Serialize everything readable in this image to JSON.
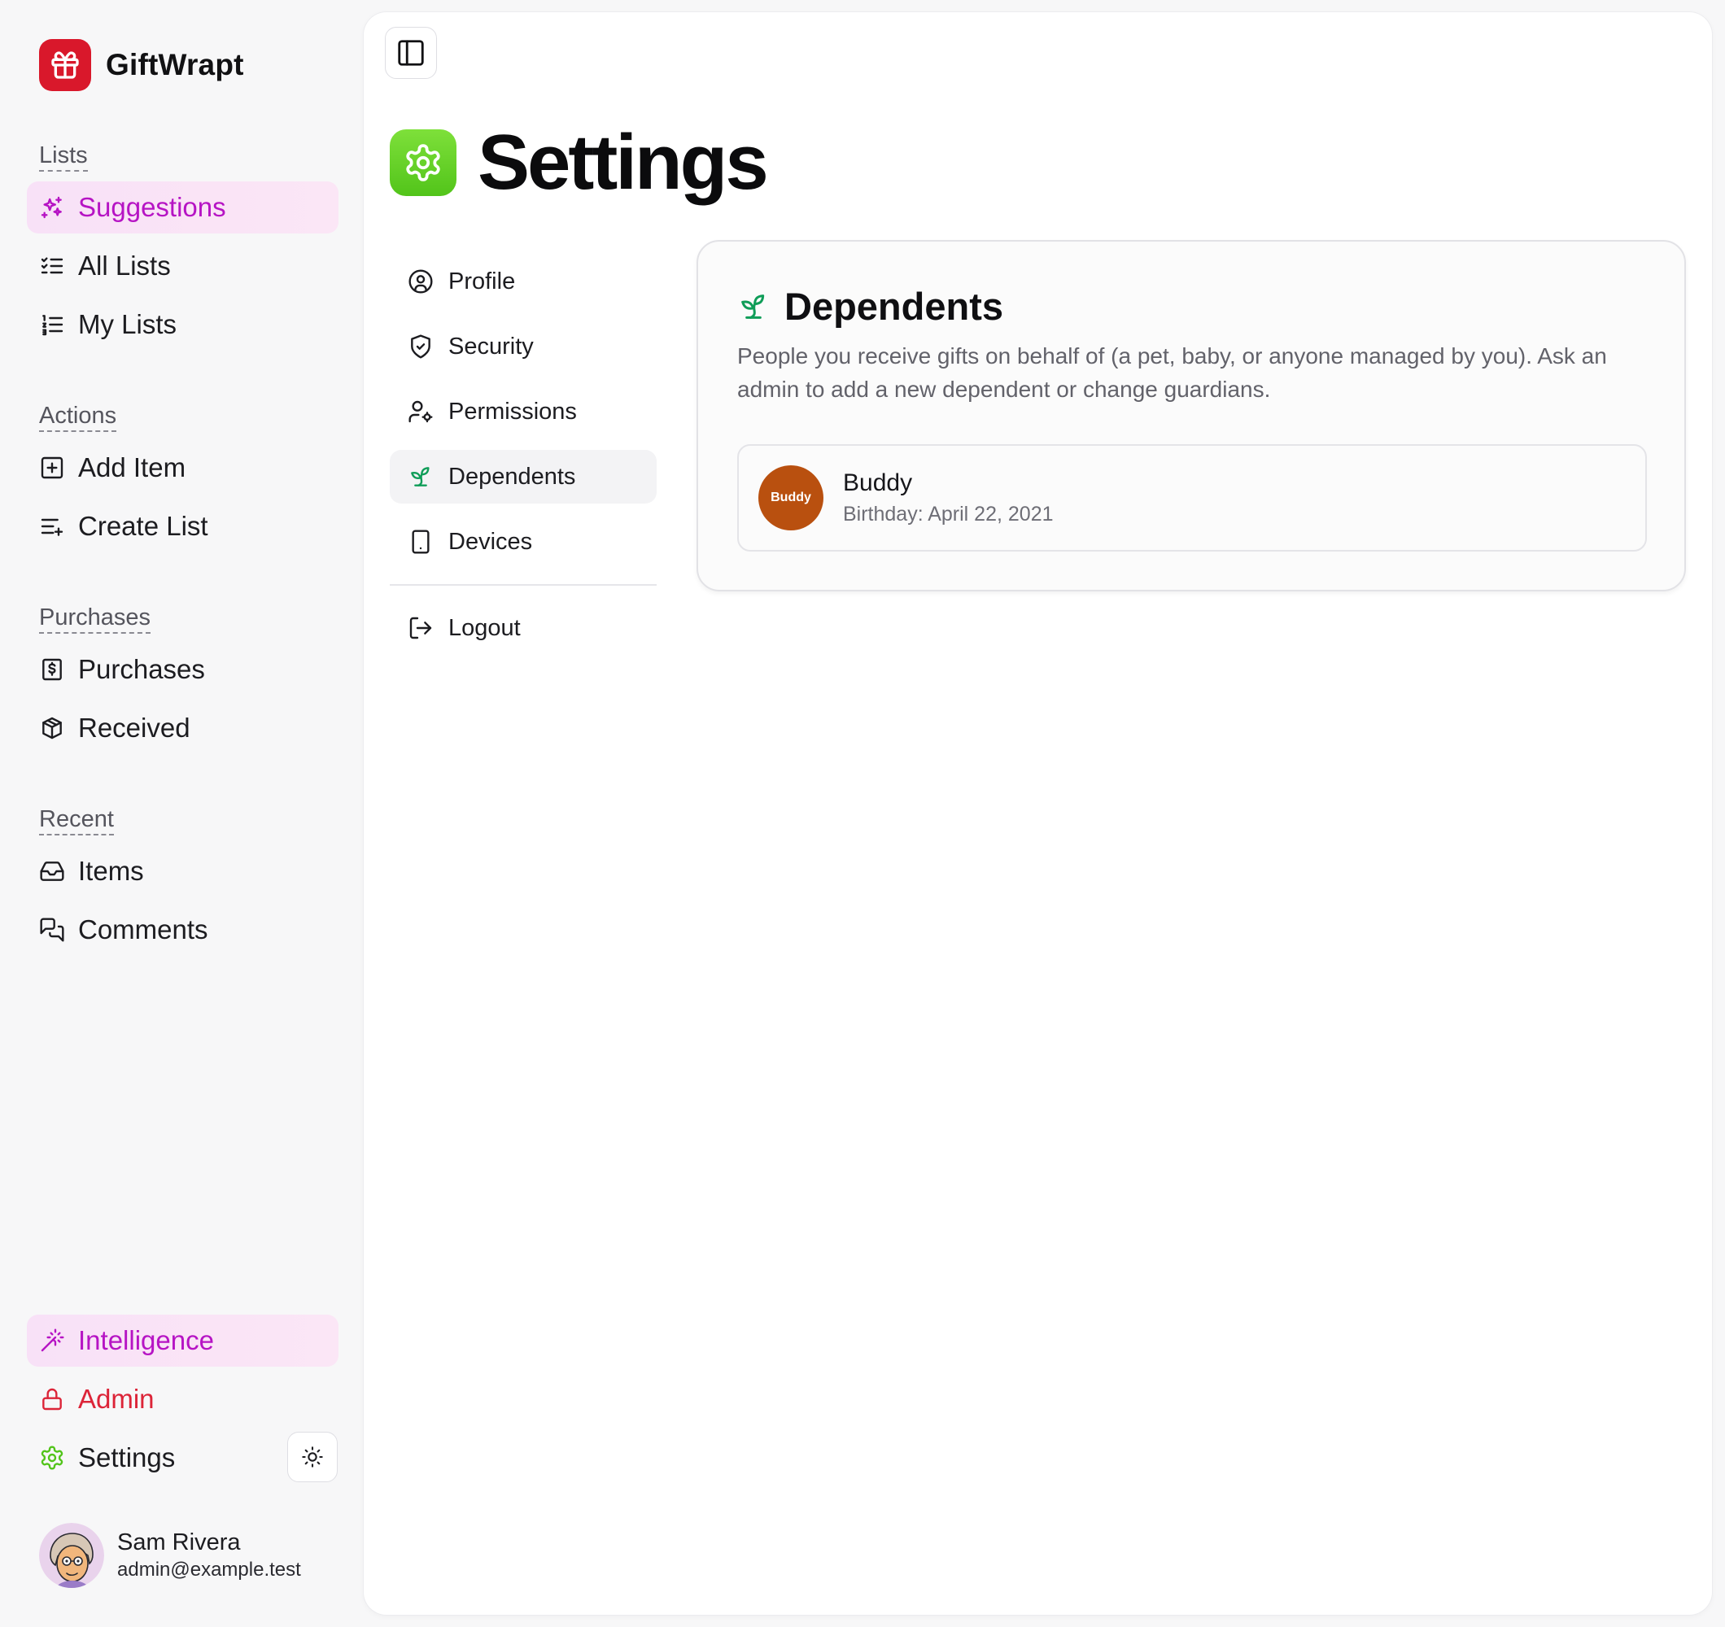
{
  "app": {
    "name": "GiftWrapt"
  },
  "sidebar": {
    "sections": [
      {
        "label": "Lists",
        "items": [
          {
            "label": "Suggestions",
            "icon": "sparkles-icon",
            "active": true
          },
          {
            "label": "All Lists",
            "icon": "list-checks-icon"
          },
          {
            "label": "My Lists",
            "icon": "list-ordered-icon"
          }
        ]
      },
      {
        "label": "Actions",
        "items": [
          {
            "label": "Add Item",
            "icon": "square-plus-icon"
          },
          {
            "label": "Create List",
            "icon": "list-plus-icon"
          }
        ]
      },
      {
        "label": "Purchases",
        "items": [
          {
            "label": "Purchases",
            "icon": "receipt-icon"
          },
          {
            "label": "Received",
            "icon": "package-icon"
          }
        ]
      },
      {
        "label": "Recent",
        "items": [
          {
            "label": "Items",
            "icon": "inbox-icon"
          },
          {
            "label": "Comments",
            "icon": "messages-icon"
          }
        ]
      }
    ],
    "bottom": {
      "intelligence": "Intelligence",
      "admin": "Admin",
      "settings": "Settings"
    },
    "user": {
      "name": "Sam Rivera",
      "email": "admin@example.test"
    }
  },
  "page": {
    "title": "Settings"
  },
  "settings_nav": {
    "items": [
      {
        "label": "Profile",
        "icon": "user-circle-icon"
      },
      {
        "label": "Security",
        "icon": "shield-check-icon"
      },
      {
        "label": "Permissions",
        "icon": "user-cog-icon"
      },
      {
        "label": "Dependents",
        "icon": "sprout-icon",
        "active": true
      },
      {
        "label": "Devices",
        "icon": "tablet-icon"
      }
    ],
    "logout": "Logout"
  },
  "dependents": {
    "title": "Dependents",
    "description": "People you receive gifts on behalf of (a pet, baby, or anyone managed by you). Ask an admin to add a new dependent or change guardians.",
    "list": [
      {
        "avatar_text": "Buddy",
        "name": "Buddy",
        "birthday": "Birthday: April 22, 2021",
        "avatar_color": "#b9500f"
      }
    ]
  },
  "colors": {
    "accent": "#b614c4",
    "brand": "#d9182b",
    "admin": "#dc2438",
    "settings_green": "#52c41a",
    "sprout_green": "#0f9d58"
  }
}
